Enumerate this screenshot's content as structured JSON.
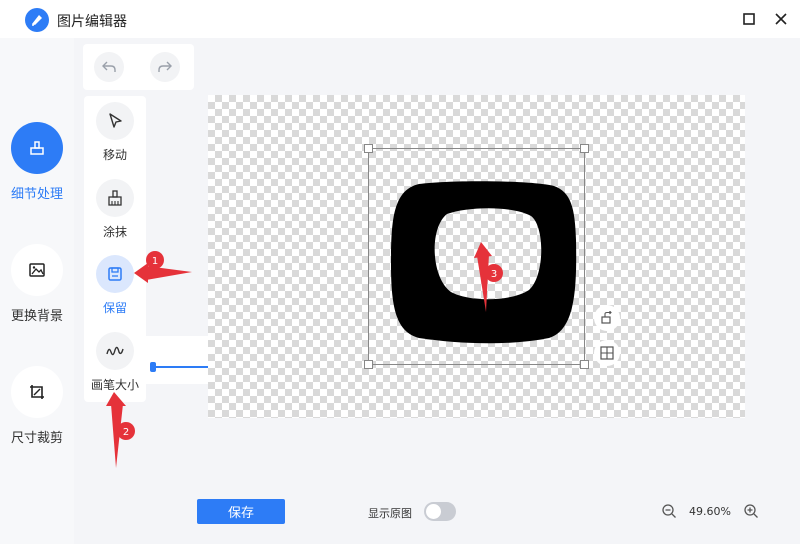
{
  "window": {
    "title": "图片编辑器"
  },
  "sidebar": {
    "items": [
      {
        "label": "细节处理",
        "icon": "brush-detail-icon",
        "active": true
      },
      {
        "label": "更换背景",
        "icon": "image-icon",
        "active": false
      },
      {
        "label": "尺寸裁剪",
        "icon": "crop-icon",
        "active": false
      }
    ]
  },
  "tools": {
    "items": [
      {
        "label": "移动",
        "icon": "cursor-icon"
      },
      {
        "label": "涂抹",
        "icon": "smear-brush-icon"
      },
      {
        "label": "保留",
        "icon": "keep-icon",
        "active": true
      },
      {
        "label": "画笔大小",
        "icon": "brush-size-icon"
      }
    ]
  },
  "brush": {
    "size": "10"
  },
  "annotations": {
    "marker1": "1",
    "marker2": "2",
    "marker3": "3"
  },
  "footer": {
    "save_label": "保存",
    "show_original_label": "显示原图",
    "show_original": false,
    "zoom": "49.60%"
  },
  "colors": {
    "accent": "#2d7cf6",
    "annotation": "#e5323a"
  }
}
